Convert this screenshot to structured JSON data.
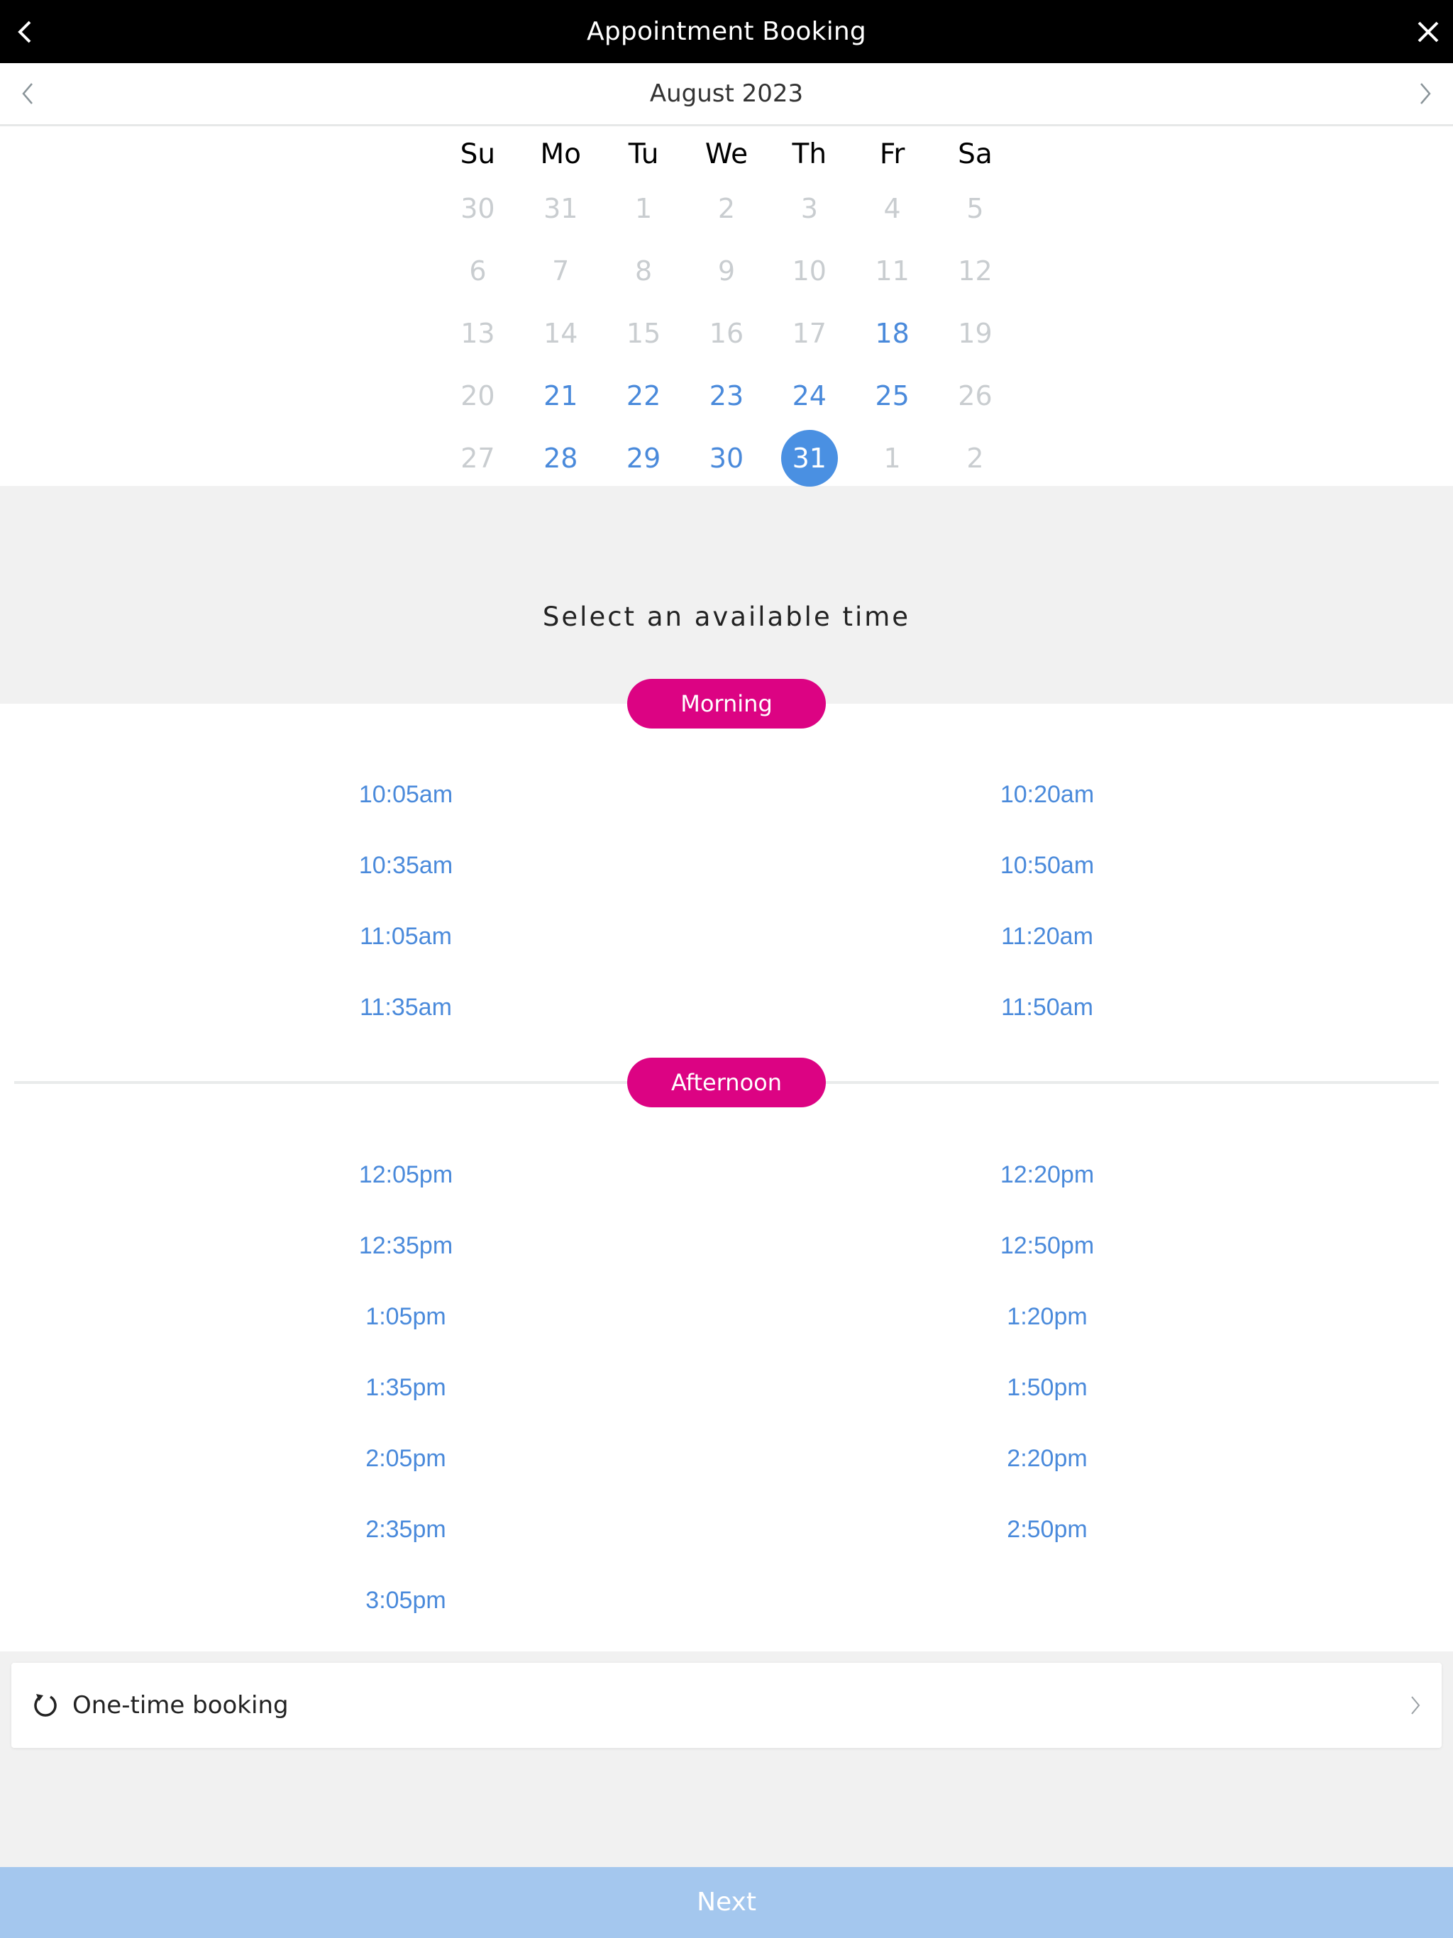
{
  "header": {
    "title": "Appointment Booking",
    "back_icon": "chevron-left-icon",
    "close_icon": "close-icon"
  },
  "month_nav": {
    "label": "August 2023",
    "prev_icon": "chevron-left-icon",
    "next_icon": "chevron-right-icon"
  },
  "calendar": {
    "weekdays": [
      "Su",
      "Mo",
      "Tu",
      "We",
      "Th",
      "Fr",
      "Sa"
    ],
    "weeks": [
      [
        {
          "d": "30",
          "s": "muted"
        },
        {
          "d": "31",
          "s": "muted"
        },
        {
          "d": "1",
          "s": "muted"
        },
        {
          "d": "2",
          "s": "muted"
        },
        {
          "d": "3",
          "s": "muted"
        },
        {
          "d": "4",
          "s": "muted"
        },
        {
          "d": "5",
          "s": "muted"
        }
      ],
      [
        {
          "d": "6",
          "s": "muted"
        },
        {
          "d": "7",
          "s": "muted"
        },
        {
          "d": "8",
          "s": "muted"
        },
        {
          "d": "9",
          "s": "muted"
        },
        {
          "d": "10",
          "s": "muted"
        },
        {
          "d": "11",
          "s": "muted"
        },
        {
          "d": "12",
          "s": "muted"
        }
      ],
      [
        {
          "d": "13",
          "s": "muted"
        },
        {
          "d": "14",
          "s": "muted"
        },
        {
          "d": "15",
          "s": "muted"
        },
        {
          "d": "16",
          "s": "muted"
        },
        {
          "d": "17",
          "s": "muted"
        },
        {
          "d": "18",
          "s": "avail"
        },
        {
          "d": "19",
          "s": "muted"
        }
      ],
      [
        {
          "d": "20",
          "s": "muted"
        },
        {
          "d": "21",
          "s": "avail"
        },
        {
          "d": "22",
          "s": "avail"
        },
        {
          "d": "23",
          "s": "avail"
        },
        {
          "d": "24",
          "s": "avail"
        },
        {
          "d": "25",
          "s": "avail"
        },
        {
          "d": "26",
          "s": "muted"
        }
      ],
      [
        {
          "d": "27",
          "s": "muted"
        },
        {
          "d": "28",
          "s": "avail"
        },
        {
          "d": "29",
          "s": "avail"
        },
        {
          "d": "30",
          "s": "avail"
        },
        {
          "d": "31",
          "s": "selected"
        },
        {
          "d": "1",
          "s": "muted"
        },
        {
          "d": "2",
          "s": "muted"
        }
      ]
    ],
    "selected_date": "31"
  },
  "times": {
    "heading": "Select an available time",
    "morning": {
      "label": "Morning",
      "slots": [
        "10:05am",
        "10:20am",
        "10:35am",
        "10:50am",
        "11:05am",
        "11:20am",
        "11:35am",
        "11:50am"
      ]
    },
    "afternoon": {
      "label": "Afternoon",
      "slots": [
        "12:05pm",
        "12:20pm",
        "12:35pm",
        "12:50pm",
        "1:05pm",
        "1:20pm",
        "1:35pm",
        "1:50pm",
        "2:05pm",
        "2:20pm",
        "2:35pm",
        "2:50pm",
        "3:05pm"
      ]
    }
  },
  "booking_type": {
    "label": "One-time booking",
    "icon": "repeat-icon",
    "chevron_icon": "chevron-right-icon"
  },
  "footer": {
    "next_label": "Next"
  },
  "colors": {
    "header_bg": "#000000",
    "accent_blue": "#4a90e2",
    "slot_text": "#4a8adb",
    "pill_magenta": "#dc0383",
    "next_disabled": "#a4c7ee",
    "muted_day": "#c9cdd0"
  }
}
